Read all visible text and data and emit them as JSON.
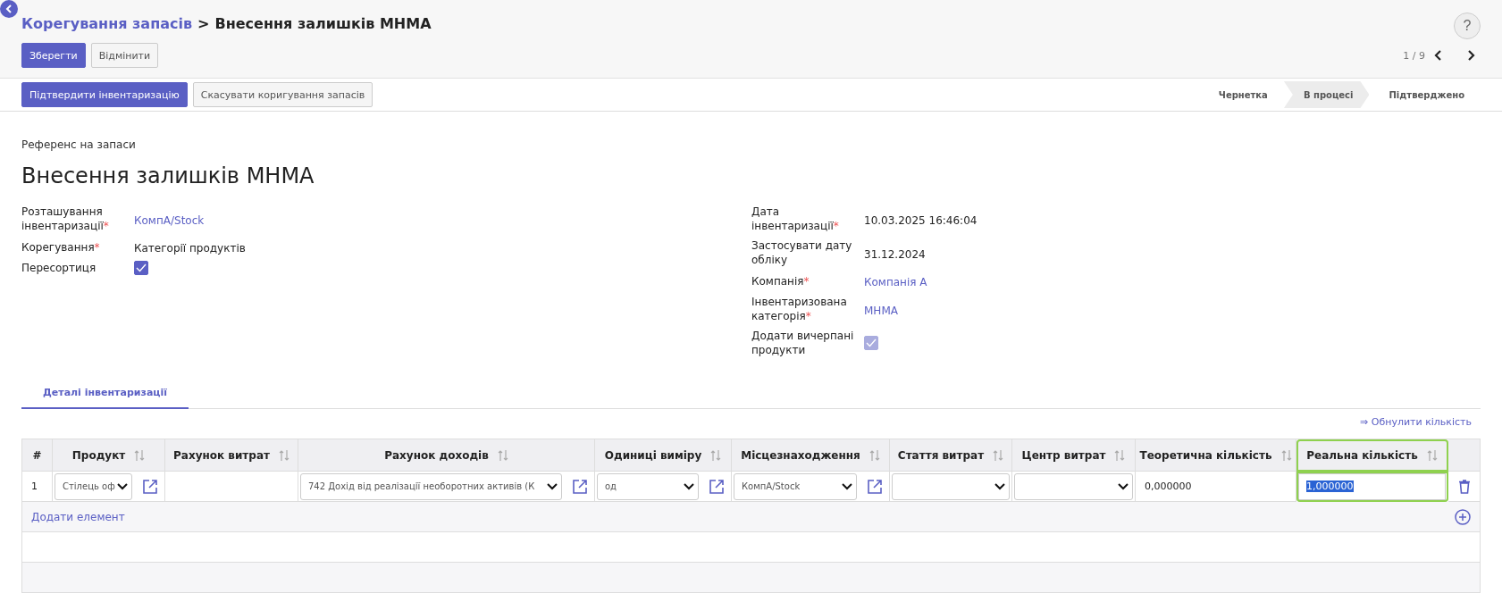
{
  "breadcrumb": {
    "parent": "Корегування запасів",
    "separator": ">",
    "current": "Внесення залишків МНМА"
  },
  "control_buttons": [
    {
      "label": "Зберегти",
      "primary": true
    },
    {
      "label": "Відмінити",
      "primary": false
    }
  ],
  "pager": {
    "text": "1 / 9"
  },
  "help": "?",
  "action_buttons": [
    {
      "label": "Підтвердити інвентаризацію",
      "primary": true
    },
    {
      "label": "Скасувати коригування запасів",
      "primary": false
    }
  ],
  "status_steps": [
    {
      "label": "Чернетка",
      "selected": false
    },
    {
      "label": "В процесі",
      "selected": true
    },
    {
      "label": "Підтверджено",
      "selected": false
    }
  ],
  "form": {
    "required_mark": "*",
    "subtitle": "Референс на запаси",
    "title": "Внесення залишків МНМА",
    "left_fields": [
      {
        "label": "Розташування інвентаризації",
        "required": true,
        "kind": "link",
        "value": "КомпА/Stock"
      },
      {
        "label": "Корегування",
        "required": true,
        "kind": "text",
        "value": "Категорії продуктів"
      },
      {
        "label": "Пересортиця",
        "required": false,
        "kind": "checkbox",
        "checked": true,
        "disabled": false
      }
    ],
    "right_fields": [
      {
        "label": "Дата інвентаризації",
        "required": true,
        "kind": "text",
        "value": "10.03.2025 16:46:04"
      },
      {
        "label": "Застосувати дату обліку",
        "required": false,
        "kind": "text",
        "value": "31.12.2024"
      },
      {
        "label": "Компанія",
        "required": true,
        "kind": "link",
        "value": "Компанія А"
      },
      {
        "label": "Інвентаризована категорія",
        "required": true,
        "kind": "link",
        "value": "МНМА"
      },
      {
        "label": "Додати вичерпані продукти",
        "required": false,
        "kind": "checkbox",
        "checked": true,
        "disabled": true
      }
    ]
  },
  "tabs": [
    {
      "label": "Деталі інвентаризації",
      "selected": true
    }
  ],
  "reset_link": "⇒ Обнулити кількість",
  "table": {
    "columns": [
      {
        "label": "#",
        "sortable": false,
        "highlighted": false
      },
      {
        "label": "Продукт",
        "sortable": true,
        "highlighted": false
      },
      {
        "label": "Рахунок витрат",
        "sortable": true,
        "highlighted": false
      },
      {
        "label": "Рахунок доходів",
        "sortable": true,
        "highlighted": false
      },
      {
        "label": "Одиниці виміру",
        "sortable": true,
        "highlighted": false
      },
      {
        "label": "Місцезнаходження",
        "sortable": true,
        "highlighted": false
      },
      {
        "label": "Стаття витрат",
        "sortable": true,
        "highlighted": false
      },
      {
        "label": "Центр витрат",
        "sortable": true,
        "highlighted": false
      },
      {
        "label": "Теоретична кількість",
        "sortable": true,
        "highlighted": false
      },
      {
        "label": "Реальна кількість",
        "sortable": true,
        "highlighted": true
      }
    ],
    "rows": [
      {
        "cells": [
          {
            "kind": "text",
            "value": "1"
          },
          {
            "kind": "select-link",
            "value": "Стілець оф"
          },
          {
            "kind": "empty"
          },
          {
            "kind": "select-link",
            "value": "742 Дохід від реалізації необоротних активів (К"
          },
          {
            "kind": "select-link",
            "value": "од"
          },
          {
            "kind": "select-link",
            "value": "КомпА/Stock"
          },
          {
            "kind": "select"
          },
          {
            "kind": "select"
          },
          {
            "kind": "text",
            "value": "0,000000"
          },
          {
            "kind": "input",
            "value": "1,000000",
            "text_selected": true
          }
        ]
      }
    ],
    "add_line": "Додати елемент"
  }
}
